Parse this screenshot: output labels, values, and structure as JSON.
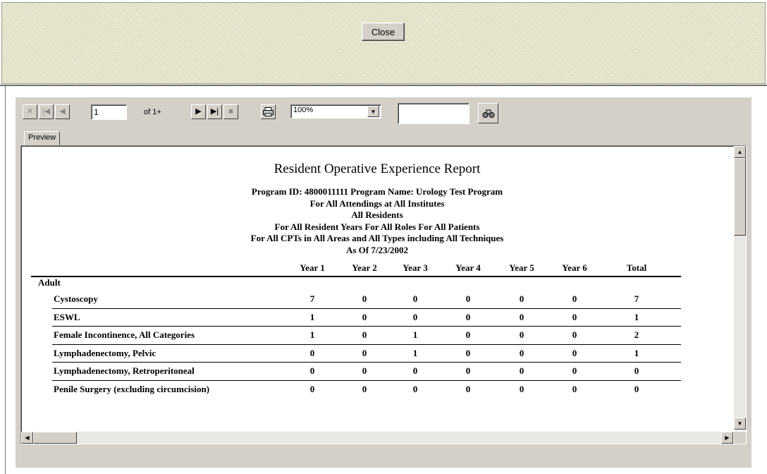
{
  "top_panel": {
    "close_label": "Close"
  },
  "toolbar": {
    "page_value": "1",
    "page_of": "of 1+",
    "zoom_value": "100%",
    "search_value": ""
  },
  "tabs": {
    "preview_label": "Preview"
  },
  "report": {
    "title": "Resident Operative Experience Report",
    "subtitle_lines": [
      "Program ID: 4800011111    Program Name: Urology Test Program",
      "For All Attendings at All Institutes",
      "All Residents",
      "For All Resident Years   For All Roles   For All Patients",
      "For All CPTs in All Areas and All Types including All Techniques",
      "As Of 7/23/2002"
    ],
    "columns": [
      "Year 1",
      "Year 2",
      "Year 3",
      "Year 4",
      "Year 5",
      "Year 6",
      "Total"
    ],
    "section": "Adult",
    "rows": [
      {
        "name": "Cystoscopy",
        "values": [
          "7",
          "0",
          "0",
          "0",
          "0",
          "0",
          "7"
        ]
      },
      {
        "name": "ESWL",
        "values": [
          "1",
          "0",
          "0",
          "0",
          "0",
          "0",
          "1"
        ]
      },
      {
        "name": "Female Incontinence, All Categories",
        "values": [
          "1",
          "0",
          "1",
          "0",
          "0",
          "0",
          "2"
        ]
      },
      {
        "name": "Lymphadenectomy, Pelvic",
        "values": [
          "0",
          "0",
          "1",
          "0",
          "0",
          "0",
          "1"
        ]
      },
      {
        "name": "Lymphadenectomy, Retroperitoneal",
        "values": [
          "0",
          "0",
          "0",
          "0",
          "0",
          "0",
          "0"
        ]
      },
      {
        "name": "Penile Surgery (excluding circumcision)",
        "values": [
          "0",
          "0",
          "0",
          "0",
          "0",
          "0",
          "0"
        ]
      }
    ]
  }
}
